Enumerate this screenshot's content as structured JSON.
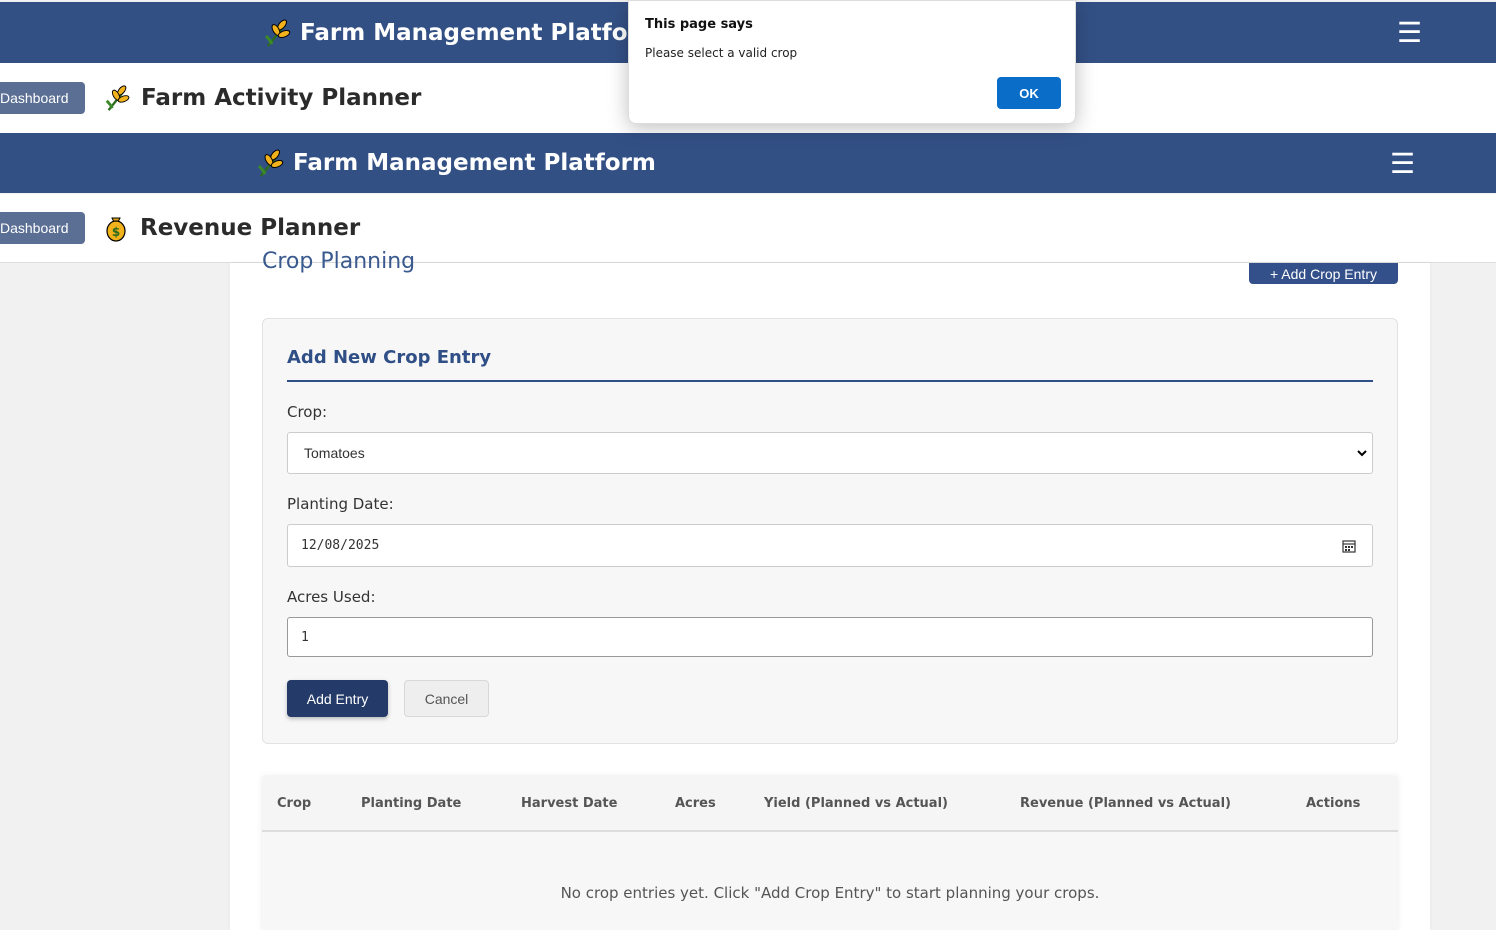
{
  "navbar": {
    "brand": "Farm Management Platform",
    "menu_icon": "hamburger-icon"
  },
  "activity_header": {
    "dashboard_label": "Dashboard",
    "title": "Farm Activity Planner"
  },
  "revenue_header": {
    "dashboard_label": "Dashboard",
    "title": "Revenue Planner"
  },
  "crop_planning": {
    "title": "Crop Planning",
    "add_button": "+ Add Crop Entry"
  },
  "form": {
    "heading": "Add New Crop Entry",
    "crop_label": "Crop:",
    "crop_value": "Tomatoes",
    "date_label": "Planting Date:",
    "date_value": "12/08/2025",
    "acres_label": "Acres Used:",
    "acres_value": "1",
    "submit_label": "Add Entry",
    "cancel_label": "Cancel"
  },
  "table": {
    "headers": [
      "Crop",
      "Planting Date",
      "Harvest Date",
      "Acres",
      "Yield (Planned vs Actual)",
      "Revenue (Planned vs Actual)",
      "Actions"
    ],
    "empty_message": "No crop entries yet. Click \"Add Crop Entry\" to start planning your crops."
  },
  "alert": {
    "title": "This page says",
    "message": "Please select a valid crop",
    "ok_label": "OK"
  },
  "colors": {
    "navbar": "#335085",
    "primary": "#243a68",
    "accent": "#2f4f86",
    "dialog_button": "#0a6dc8"
  }
}
